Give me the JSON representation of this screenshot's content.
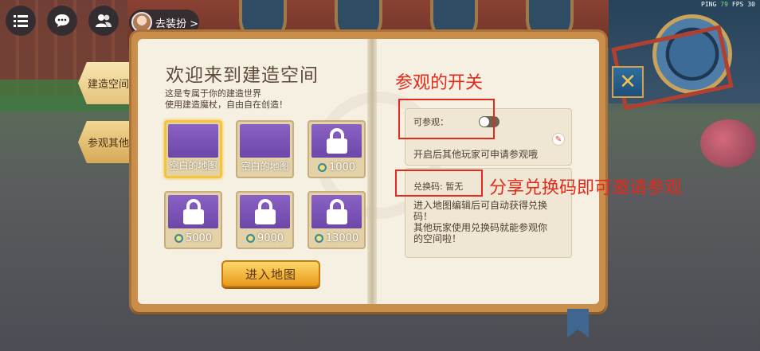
{
  "hud": {
    "dress_up": "去装扮 >",
    "ping_label": "PING",
    "ping_value": "79",
    "fps_label": "FPS",
    "fps_value": "30"
  },
  "tabs": [
    {
      "label": "建造空间",
      "active": true
    },
    {
      "label": "参观其他",
      "active": false
    }
  ],
  "left_page": {
    "title": "欢迎来到建造空间",
    "desc_line1": "这是专属于你的建造世界",
    "desc_line2": "使用建造魔杖，自由自在创造！",
    "maps": [
      {
        "label": "空白的地图",
        "locked": false,
        "selected": true
      },
      {
        "label": "空白的地图",
        "locked": false,
        "selected": false
      },
      {
        "price": "1000",
        "locked": true
      },
      {
        "price": "5000",
        "locked": true
      },
      {
        "price": "9000",
        "locked": true
      },
      {
        "price": "13000",
        "locked": true
      }
    ],
    "enter_button": "进入地图"
  },
  "right_page": {
    "visit_label": "可参观：",
    "visit_toggle_on": false,
    "visit_desc": "开启后其他玩家可申请参观哦",
    "code_label": "兑换码: 暂无",
    "code_desc_line1": "进入地图编辑后可自动获得兑换",
    "code_desc_line2": "码！",
    "code_desc_line3": "其他玩家使用兑换码就能参观你",
    "code_desc_line4": "的空间啦！"
  },
  "annotations": {
    "toggle_note": "参观的开关",
    "code_note": "分享兑换码即可邀请参观",
    "color": "#e42a1c"
  },
  "colors": {
    "page_bg": "#f6f0e2",
    "book_frame": "#c98f4a",
    "card_purple": "#7a54b8",
    "selected_outline": "#f4c43a",
    "button_gold": "#f4b43a",
    "close_blue": "#2d6ea0"
  }
}
